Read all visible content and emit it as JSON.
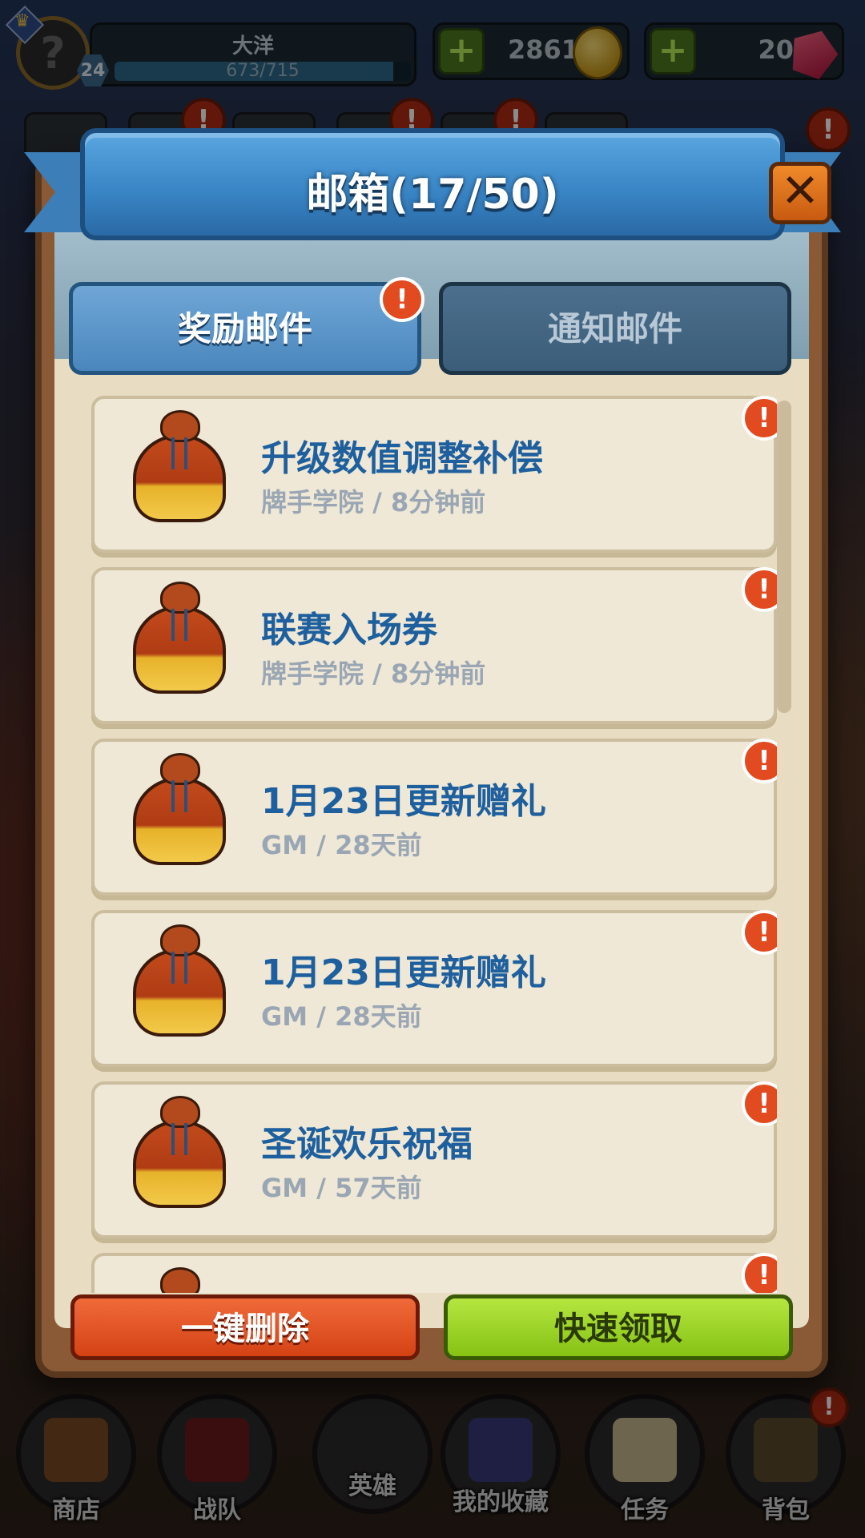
{
  "player": {
    "name": "大洋",
    "level": "24",
    "xp_text": "673/715",
    "xp_fraction": 0.94
  },
  "resources": {
    "coins": "2861",
    "gems": "20"
  },
  "panel": {
    "title": "邮箱(17/50)",
    "close_label": "✕",
    "tabs": {
      "reward": "奖励邮件",
      "notice": "通知邮件"
    },
    "alert_glyph": "!"
  },
  "mails": [
    {
      "title": "升级数值调整补偿",
      "sender": "牌手学院",
      "time": "8分钟前",
      "sub": "牌手学院 / 8分钟前"
    },
    {
      "title": "联赛入场券",
      "sender": "牌手学院",
      "time": "8分钟前",
      "sub": "牌手学院 / 8分钟前"
    },
    {
      "title": "1月23日更新赠礼",
      "sender": "GM",
      "time": "28天前",
      "sub": "GM / 28天前"
    },
    {
      "title": "1月23日更新赠礼",
      "sender": "GM",
      "time": "28天前",
      "sub": "GM / 28天前"
    },
    {
      "title": "圣诞欢乐祝福",
      "sender": "GM",
      "time": "57天前",
      "sub": "GM / 57天前"
    }
  ],
  "actions": {
    "delete_all": "一键删除",
    "quick_claim": "快速领取"
  },
  "bottom_nav": {
    "shop": "商店",
    "team": "战队",
    "heroes": "英雄",
    "collection": "我的收藏",
    "tasks": "任务",
    "bag": "背包"
  },
  "colors": {
    "ribbon": "#3a86c6",
    "title_blue": "#1e5f9e",
    "alert_red": "#e24a20",
    "delete_red": "#d44214",
    "claim_green": "#86c214"
  },
  "icons": {
    "mail_item": "money-bag-icon",
    "coin": "gold-coin-icon",
    "gem": "gem-icon",
    "add": "plus-icon",
    "close": "close-icon",
    "alert": "exclamation-icon"
  }
}
